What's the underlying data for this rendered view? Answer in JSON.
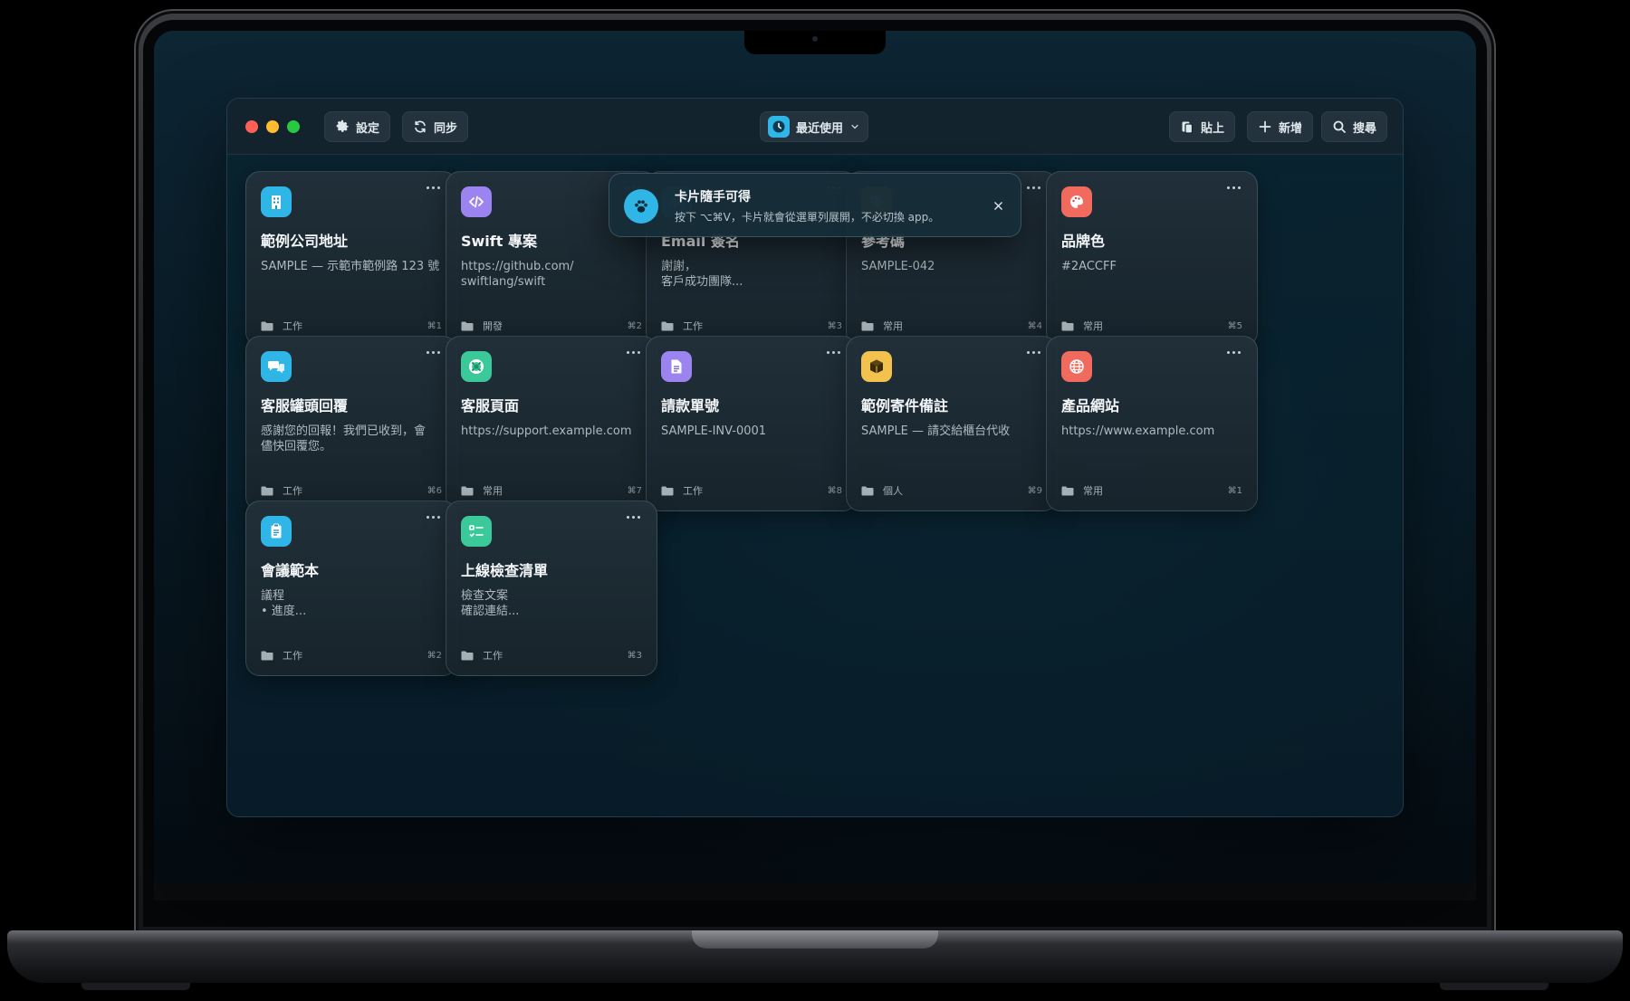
{
  "toolbar": {
    "settings_label": "設定",
    "sync_label": "同步",
    "recent_label": "最近使用",
    "paste_label": "貼上",
    "new_label": "新增",
    "search_label": "搜尋"
  },
  "toast": {
    "title": "卡片隨手可得",
    "message": "按下 ⌥⌘V，卡片就會從選單列展開，不必切換 app。"
  },
  "cards": [
    {
      "title": "範例公司地址",
      "body": "SAMPLE — 示範市範例路 123 號",
      "category": "工作",
      "shortcut": "⌘1",
      "icon": "building-icon",
      "color": "#2fb6e6"
    },
    {
      "title": "Swift 專案",
      "body": "https://github.com/\nswiftlang/swift",
      "category": "開發",
      "shortcut": "⌘2",
      "icon": "code-icon",
      "color": "#9b84f0"
    },
    {
      "title": "Email 簽名",
      "body": "謝謝，\n客戶成功團隊...",
      "category": "工作",
      "shortcut": "⌘3",
      "icon": "signature-icon",
      "color": "#4aa3f0"
    },
    {
      "title": "參考碼",
      "body": "SAMPLE-042",
      "category": "常用",
      "shortcut": "⌘4",
      "icon": "tag-icon",
      "color": "#e0a83a"
    },
    {
      "title": "品牌色",
      "body": "#2ACCFF",
      "category": "常用",
      "shortcut": "⌘5",
      "icon": "palette-icon",
      "color": "#f06a5e"
    },
    {
      "title": "客服罐頭回覆",
      "body": "感謝您的回報！我們已收到，會\n儘快回覆您。",
      "category": "工作",
      "shortcut": "⌘6",
      "icon": "chat-bubbles-icon",
      "color": "#2fb6e6"
    },
    {
      "title": "客服頁面",
      "body": "https://support.example.com",
      "category": "常用",
      "shortcut": "⌘7",
      "icon": "lifebuoy-icon",
      "color": "#3cc99a"
    },
    {
      "title": "請款單號",
      "body": "SAMPLE-INV-0001",
      "category": "工作",
      "shortcut": "⌘8",
      "icon": "document-icon",
      "color": "#9b84f0"
    },
    {
      "title": "範例寄件備註",
      "body": "SAMPLE — 請交給櫃台代收",
      "category": "個人",
      "shortcut": "⌘9",
      "icon": "package-icon",
      "color": "#f2c14e"
    },
    {
      "title": "產品網站",
      "body": "https://www.example.com",
      "category": "常用",
      "shortcut": "⌘1",
      "icon": "globe-icon",
      "color": "#f06a5e"
    },
    {
      "title": "會議範本",
      "body": "議程\n• 進度...",
      "category": "工作",
      "shortcut": "⌘2",
      "icon": "clipboard-icon",
      "color": "#2fb6e6"
    },
    {
      "title": "上線檢查清單",
      "body": "檢查文案\n確認連結...",
      "category": "工作",
      "shortcut": "⌘3",
      "icon": "checklist-icon",
      "color": "#3cc99a"
    }
  ]
}
